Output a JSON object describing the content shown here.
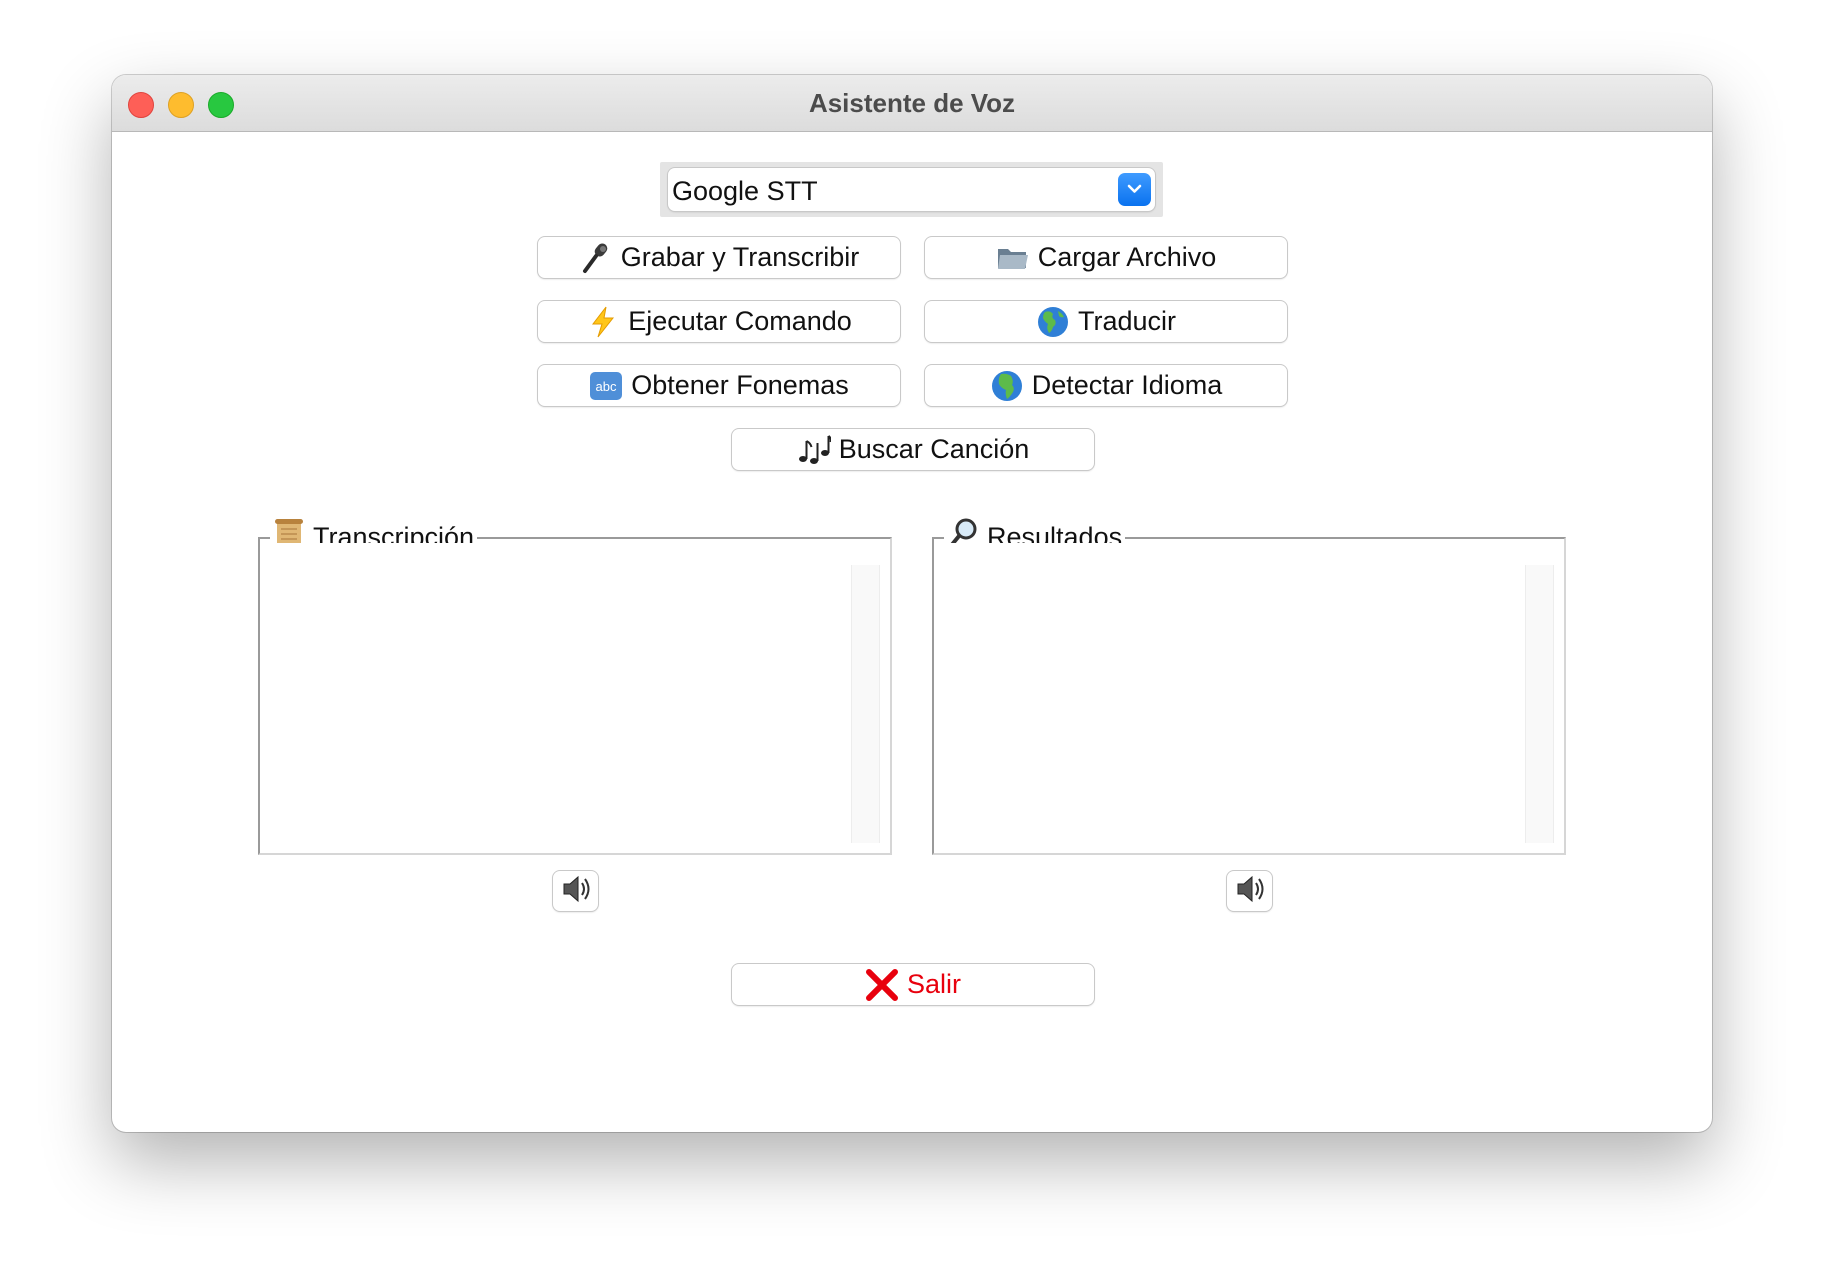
{
  "window": {
    "title": "Asistente de Voz"
  },
  "engine_select": {
    "value": "Google STT"
  },
  "buttons": {
    "record": "Grabar y Transcribir",
    "load_file": "Cargar Archivo",
    "run_command": "Ejecutar Comando",
    "translate": "Traducir",
    "phonemes": "Obtener Fonemas",
    "detect_language": "Detectar Idioma",
    "search_song": "Buscar Canción",
    "exit": "Salir"
  },
  "panels": {
    "transcription": {
      "label": "Transcripción",
      "text": ""
    },
    "results": {
      "label": "Resultados",
      "text": ""
    }
  },
  "icons": {
    "record": "microphone-icon",
    "load_file": "folder-icon",
    "run_command": "lightning-icon",
    "translate": "globe-americas-icon",
    "phonemes": "abc-icon",
    "detect_language": "globe-africa-icon",
    "search_song": "music-notes-icon",
    "exit": "cross-mark-icon",
    "transcription": "scroll-icon",
    "results": "magnifier-icon",
    "speak": "speaker-icon"
  },
  "colors": {
    "exit_text": "#e8000d",
    "select_accent": "#0a72ef",
    "close": "#fe5f57",
    "minimize": "#febc2e",
    "maximize": "#28c840"
  }
}
